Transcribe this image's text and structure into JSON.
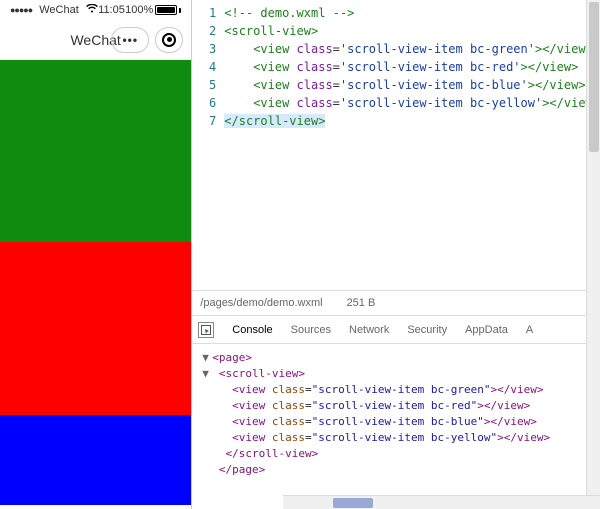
{
  "domain": "Computer-Use",
  "phone": {
    "carrier": "WeChat",
    "time": "11:05",
    "battery_pct": "100%",
    "title": "WeChat"
  },
  "editor": {
    "file_path": "/pages/demo/demo.wxml",
    "file_size": "251 B",
    "lines": [
      {
        "n": "1",
        "indent": "",
        "kind": "comment",
        "text": "<!-- demo.wxml -->"
      },
      {
        "n": "2",
        "indent": "",
        "kind": "open",
        "tag": "scroll-view"
      },
      {
        "n": "3",
        "indent": "    ",
        "kind": "elem",
        "tag": "view",
        "attr": "class",
        "val": "scroll-view-item bc-green",
        "close": "view"
      },
      {
        "n": "4",
        "indent": "    ",
        "kind": "elem",
        "tag": "view",
        "attr": "class",
        "val": "scroll-view-item bc-red",
        "close": "view"
      },
      {
        "n": "5",
        "indent": "    ",
        "kind": "elem",
        "tag": "view",
        "attr": "class",
        "val": "scroll-view-item bc-blue",
        "close": "view"
      },
      {
        "n": "6",
        "indent": "    ",
        "kind": "elem",
        "tag": "view",
        "attr": "class",
        "val": "scroll-view-item bc-yellow",
        "close": "view"
      },
      {
        "n": "7",
        "indent": "",
        "kind": "close",
        "tag": "scroll-view",
        "selected": true
      }
    ]
  },
  "tabs": {
    "items": [
      "Console",
      "Sources",
      "Network",
      "Security",
      "AppData",
      "A"
    ],
    "active_index": 0
  },
  "inspector": {
    "lines": [
      {
        "indent": "",
        "tri": "▼",
        "kind": "open",
        "tag": "page"
      },
      {
        "indent": " ",
        "tri": "▼",
        "kind": "open",
        "tag": "scroll-view"
      },
      {
        "indent": "   ",
        "tri": "",
        "kind": "elem",
        "tag": "view",
        "attr": "class",
        "val": "scroll-view-item bc-green",
        "close": "view"
      },
      {
        "indent": "   ",
        "tri": "",
        "kind": "elem",
        "tag": "view",
        "attr": "class",
        "val": "scroll-view-item bc-red",
        "close": "view"
      },
      {
        "indent": "   ",
        "tri": "",
        "kind": "elem",
        "tag": "view",
        "attr": "class",
        "val": "scroll-view-item bc-blue",
        "close": "view"
      },
      {
        "indent": "   ",
        "tri": "",
        "kind": "elem",
        "tag": "view",
        "attr": "class",
        "val": "scroll-view-item bc-yellow",
        "close": "view"
      },
      {
        "indent": "  ",
        "tri": "",
        "kind": "close",
        "tag": "scroll-view"
      },
      {
        "indent": " ",
        "tri": "",
        "kind": "close",
        "tag": "page"
      }
    ]
  },
  "scroll_items": [
    {
      "cls": "bc-green"
    },
    {
      "cls": "bc-red"
    },
    {
      "cls": "bc-blue"
    }
  ]
}
